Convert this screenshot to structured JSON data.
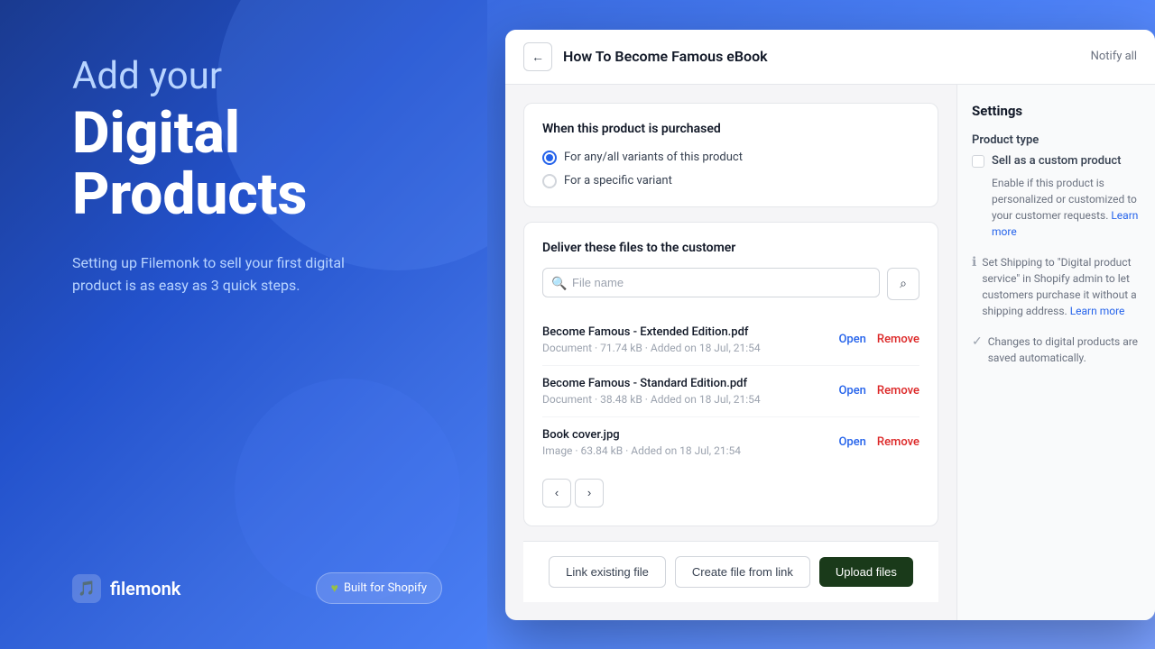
{
  "left": {
    "headline_top": "Add your",
    "headline_bold_line1": "Digital",
    "headline_bold_line2": "Products",
    "subtitle": "Setting up Filemonk to sell your first digital product is as easy as 3 quick steps.",
    "logo_text": "filemonk",
    "shopify_badge": "Built for Shopify"
  },
  "app": {
    "title": "How To Become Famous eBook",
    "notify_label": "Notify all",
    "back_icon": "←",
    "when_purchased": {
      "title": "When this product is purchased",
      "radio_options": [
        {
          "label": "For any/all variants of this product",
          "selected": true
        },
        {
          "label": "For a specific variant",
          "selected": false
        }
      ]
    },
    "deliver_files": {
      "title": "Deliver these files to the customer",
      "search_placeholder": "File name",
      "files": [
        {
          "name": "Become Famous - Extended Edition.pdf",
          "type": "Document",
          "size": "71.74 kB",
          "added": "Added on 18 Jul, 21:54"
        },
        {
          "name": "Become Famous - Standard Edition.pdf",
          "type": "Document",
          "size": "38.48 kB",
          "added": "Added on 18 Jul, 21:54"
        },
        {
          "name": "Book cover.jpg",
          "type": "Image",
          "size": "63.84 kB",
          "added": "Added on 18 Jul, 21:54"
        }
      ],
      "open_label": "Open",
      "remove_label": "Remove",
      "prev_icon": "‹",
      "next_icon": "›"
    },
    "actions": {
      "link_existing": "Link existing file",
      "create_from_link": "Create file from link",
      "upload_files": "Upload files"
    }
  },
  "settings": {
    "title": "Settings",
    "product_type_label": "Product type",
    "custom_product_label": "Sell as a custom product",
    "custom_product_desc": "Enable if this product is personalized or customized to your customer requests.",
    "learn_more_1": "Learn more",
    "shipping_info": "Set Shipping to \"Digital product service\" in Shopify admin to let customers purchase it without a shipping address.",
    "learn_more_2": "Learn more",
    "auto_save_text": "Changes to digital products are saved automatically."
  }
}
